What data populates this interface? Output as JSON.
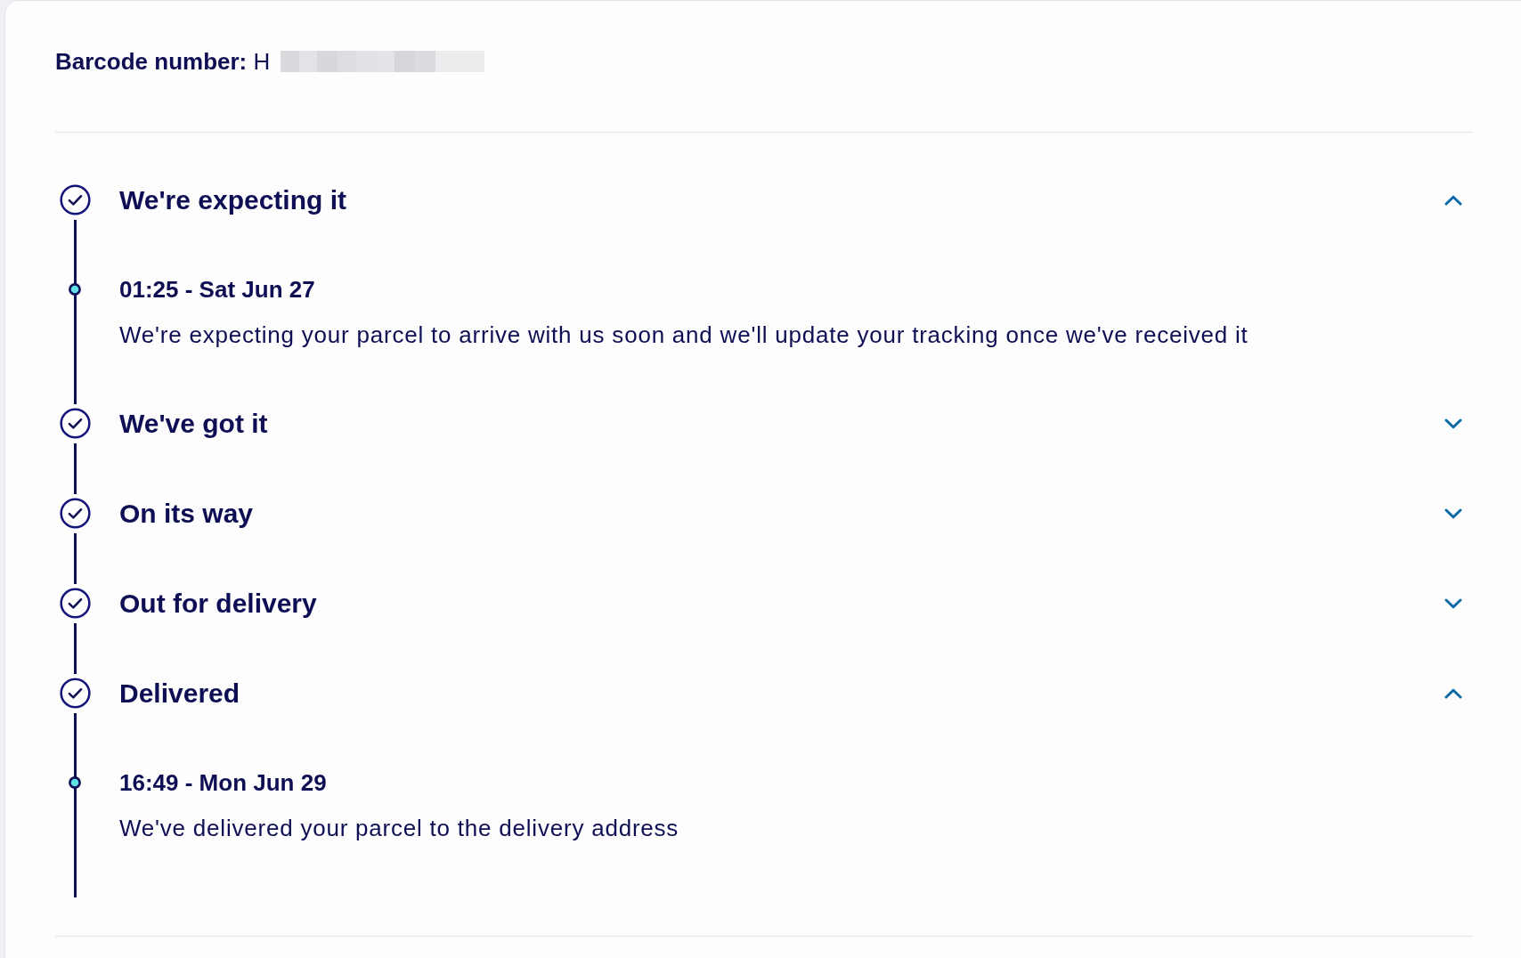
{
  "barcode": {
    "label": "Barcode number:",
    "value": "H",
    "redacted": true
  },
  "steps": [
    {
      "title": "We're expecting it",
      "completed": true,
      "expanded": true,
      "events": [
        {
          "time": "01:25 - Sat Jun 27",
          "description": "We're expecting your parcel to arrive with us soon and we'll update your tracking once we've received it"
        }
      ]
    },
    {
      "title": "We've got it",
      "completed": true,
      "expanded": false
    },
    {
      "title": "On its way",
      "completed": true,
      "expanded": false
    },
    {
      "title": "Out for delivery",
      "completed": true,
      "expanded": false
    },
    {
      "title": "Delivered",
      "completed": true,
      "expanded": true,
      "events": [
        {
          "time": "16:49 - Mon Jun 29",
          "description": "We've delivered your parcel to the delivery address"
        }
      ]
    }
  ]
}
